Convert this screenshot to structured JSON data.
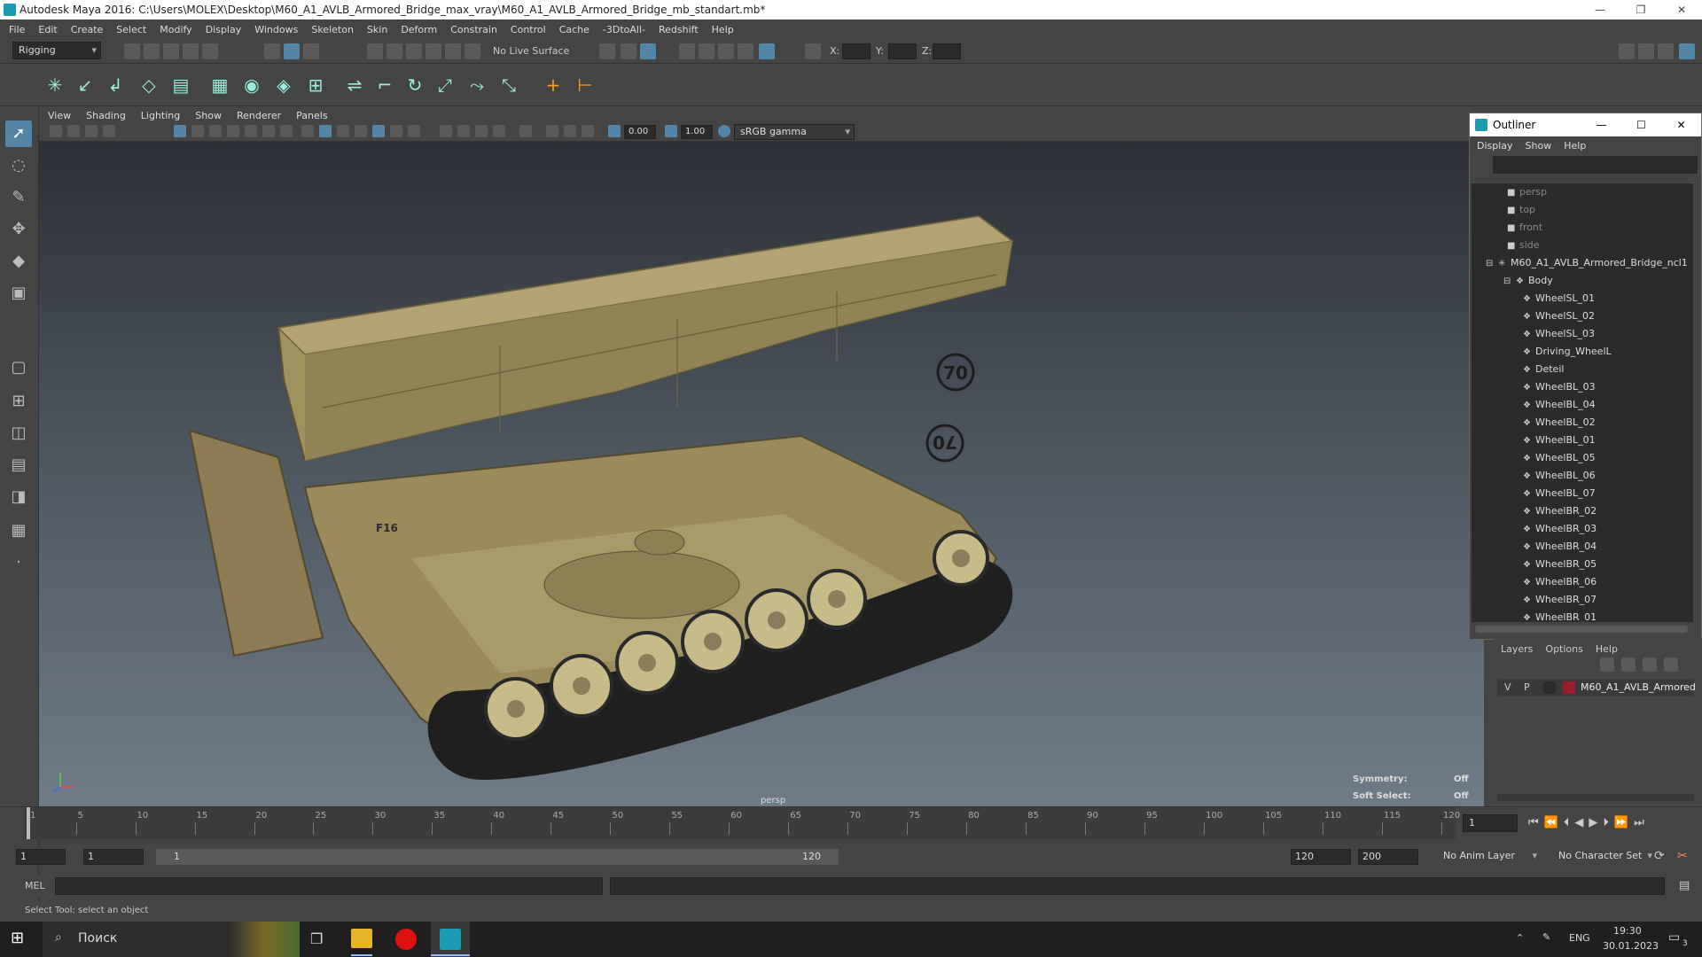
{
  "window": {
    "title": "Autodesk Maya 2016: C:\\Users\\MOLEX\\Desktop\\M60_A1_AVLB_Armored_Bridge_max_vray\\M60_A1_AVLB_Armored_Bridge_mb_standart.mb*",
    "minimize": "—",
    "restore": "❐",
    "close": "✕"
  },
  "menubar": [
    "File",
    "Edit",
    "Create",
    "Select",
    "Modify",
    "Display",
    "Windows",
    "Skeleton",
    "Skin",
    "Deform",
    "Constrain",
    "Control",
    "Cache",
    "-3DtoAll-",
    "Redshift",
    "Help"
  ],
  "statusline": {
    "mode": "Rigging",
    "live_surface": "No Live Surface",
    "x_label": "X:",
    "y_label": "Y:",
    "z_label": "Z:"
  },
  "panel_menu": [
    "View",
    "Shading",
    "Lighting",
    "Show",
    "Renderer",
    "Panels"
  ],
  "panel_toolbar": {
    "exposure": "0.00",
    "gamma": "1.00",
    "color_space": "sRGB gamma"
  },
  "viewport": {
    "camera_label": "persp",
    "hud": {
      "symmetry_label": "Symmetry:",
      "symmetry_value": "Off",
      "soft_select_label": "Soft Select:",
      "soft_select_value": "Off"
    },
    "model": {
      "decal_top": "70",
      "decal_bottom": "70",
      "hull_text": "F16"
    }
  },
  "outliner": {
    "title": "Outliner",
    "menu": [
      "Display",
      "Show",
      "Help"
    ],
    "items": [
      {
        "label": "persp",
        "type": "camera"
      },
      {
        "label": "top",
        "type": "camera"
      },
      {
        "label": "front",
        "type": "camera"
      },
      {
        "label": "side",
        "type": "camera"
      },
      {
        "label": "M60_A1_AVLB_Armored_Bridge_ncl1",
        "type": "group"
      },
      {
        "label": "Body",
        "type": "group"
      },
      {
        "label": "WheelSL_01",
        "type": "mesh"
      },
      {
        "label": "WheelSL_02",
        "type": "mesh"
      },
      {
        "label": "WheelSL_03",
        "type": "mesh"
      },
      {
        "label": "Driving_WheelL",
        "type": "mesh"
      },
      {
        "label": "Deteil",
        "type": "mesh"
      },
      {
        "label": "WheelBL_03",
        "type": "mesh"
      },
      {
        "label": "WheelBL_04",
        "type": "mesh"
      },
      {
        "label": "WheelBL_02",
        "type": "mesh"
      },
      {
        "label": "WheelBL_01",
        "type": "mesh"
      },
      {
        "label": "WheelBL_05",
        "type": "mesh"
      },
      {
        "label": "WheelBL_06",
        "type": "mesh"
      },
      {
        "label": "WheelBL_07",
        "type": "mesh"
      },
      {
        "label": "WheelBR_02",
        "type": "mesh"
      },
      {
        "label": "WheelBR_03",
        "type": "mesh"
      },
      {
        "label": "WheelBR_04",
        "type": "mesh"
      },
      {
        "label": "WheelBR_05",
        "type": "mesh"
      },
      {
        "label": "WheelBR_06",
        "type": "mesh"
      },
      {
        "label": "WheelBR_07",
        "type": "mesh"
      },
      {
        "label": "WheelBR_01",
        "type": "mesh"
      }
    ]
  },
  "layer_editor": {
    "menu": [
      "Layers",
      "Options",
      "Help"
    ],
    "layer": {
      "v": "V",
      "p": "P",
      "name": "M60_A1_AVLB_Armored",
      "color": "#9b1c2c"
    }
  },
  "timeline": {
    "ticks": [
      "1",
      "5",
      "10",
      "15",
      "20",
      "25",
      "30",
      "35",
      "40",
      "45",
      "50",
      "55",
      "60",
      "65",
      "70",
      "75",
      "80",
      "85",
      "90",
      "95",
      "100",
      "105",
      "110",
      "115",
      "120"
    ],
    "current_frame": "1"
  },
  "range": {
    "start": "1",
    "playback_start": "1",
    "slider_start": "1",
    "slider_end": "120",
    "playback_end": "120",
    "end": "200",
    "anim_layer": "No Anim Layer",
    "character_set": "No Character Set"
  },
  "command_line": {
    "label": "MEL"
  },
  "help_line": "Select Tool: select an object",
  "taskbar": {
    "search": "Поиск",
    "lang": "ENG",
    "time": "19:30",
    "date": "30.01.2023",
    "notifications": "3"
  }
}
